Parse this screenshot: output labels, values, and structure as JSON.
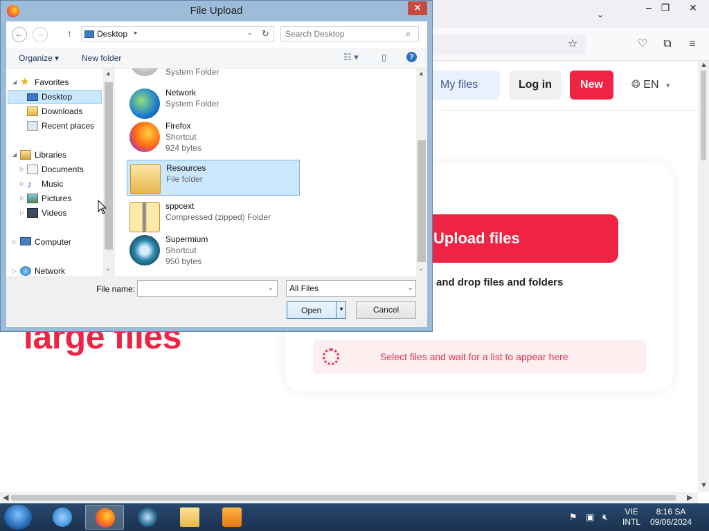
{
  "dialog": {
    "title": "File Upload",
    "close_glyph": "✕",
    "address": {
      "location": "Desktop",
      "chevron": "▸",
      "dropdown": "⌄"
    },
    "search": {
      "placeholder": "Search Desktop"
    },
    "commands": {
      "organize": "Organize ▾",
      "new_folder": "New folder"
    },
    "tree": {
      "items": [
        {
          "label": "Favorites",
          "icon": "star-icon"
        },
        {
          "label": "Desktop",
          "icon": "desktop-icon",
          "selected": true
        },
        {
          "label": "Downloads",
          "icon": "downloads-icon"
        },
        {
          "label": "Recent places",
          "icon": "recent-places-icon"
        },
        {
          "label": "Libraries",
          "icon": "libraries-icon"
        },
        {
          "label": "Documents",
          "icon": "documents-icon"
        },
        {
          "label": "Music",
          "icon": "music-icon"
        },
        {
          "label": "Pictures",
          "icon": "pictures-icon"
        },
        {
          "label": "Videos",
          "icon": "videos-icon"
        },
        {
          "label": "Computer",
          "icon": "computer-icon"
        },
        {
          "label": "Network",
          "icon": "network-icon"
        }
      ]
    },
    "files": [
      {
        "name": "",
        "type": "System Folder",
        "size": "",
        "icon": "folder-icon"
      },
      {
        "name": "Network",
        "type": "System Folder",
        "size": "",
        "icon": "network-globe-icon"
      },
      {
        "name": "Firefox",
        "type": "Shortcut",
        "size": "924 bytes",
        "icon": "firefox-icon"
      },
      {
        "name": "Resources",
        "type": "File folder",
        "size": "",
        "icon": "folder-icon",
        "selected": true
      },
      {
        "name": "sppcext",
        "type": "Compressed (zipped) Folder",
        "size": "",
        "icon": "zip-folder-icon"
      },
      {
        "name": "Supermium",
        "type": "Shortcut",
        "size": "950 bytes",
        "icon": "supermium-icon"
      }
    ],
    "file_name": {
      "label": "File name:",
      "value": ""
    },
    "file_type": {
      "value": "All Files"
    },
    "buttons": {
      "open": "Open",
      "cancel": "Cancel"
    }
  },
  "site": {
    "my_files": "My files",
    "log_in": "Log in",
    "new": "New",
    "language": "EN",
    "upload_button": "Upload files",
    "drop_text": "and drop files and folders",
    "select_hint": "Select files and wait for a list to appear here",
    "hero_fragment": "large files"
  },
  "taskbar": {
    "lang_top": "VIE",
    "lang_bottom": "INTL",
    "time": "8:16 SA",
    "date": "09/06/2024"
  },
  "colors": {
    "accent_red": "#ef2343",
    "selection_blue": "#cce8ff",
    "taskbar_blue": "#1f3a5a"
  }
}
